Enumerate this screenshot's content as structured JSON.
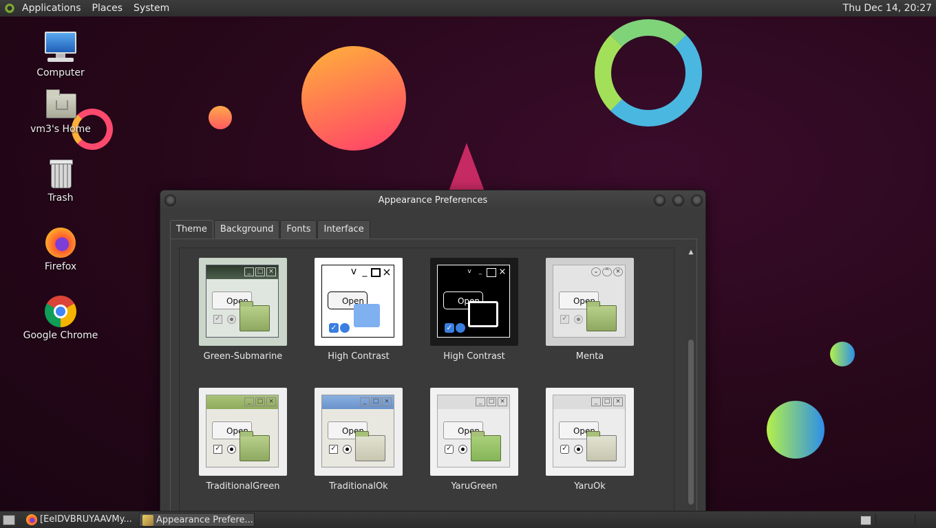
{
  "top_panel": {
    "menus": [
      "Applications",
      "Places",
      "System"
    ],
    "clock": "Thu Dec 14, 20:27"
  },
  "desktop_icons": [
    {
      "label": "Computer",
      "icon": "computer-icon"
    },
    {
      "label": "vm3's Home",
      "icon": "home-folder-icon"
    },
    {
      "label": "Trash",
      "icon": "trash-icon"
    },
    {
      "label": "Firefox",
      "icon": "firefox-icon"
    },
    {
      "label": "Google Chrome",
      "icon": "chrome-icon"
    }
  ],
  "window": {
    "title": "Appearance Preferences",
    "tabs": [
      "Theme",
      "Background",
      "Fonts",
      "Interface"
    ],
    "active_tab": "Theme",
    "themes": [
      {
        "name": "Green-Submarine",
        "open_label": "Open"
      },
      {
        "name": "High Contrast",
        "open_label": "Open"
      },
      {
        "name": "High Contrast",
        "open_label": "Open"
      },
      {
        "name": "Menta",
        "open_label": "Open"
      },
      {
        "name": "TraditionalGreen",
        "open_label": "Open"
      },
      {
        "name": "TraditionalOk",
        "open_label": "Open"
      },
      {
        "name": "YaruGreen",
        "open_label": "Open"
      },
      {
        "name": "YaruOk",
        "open_label": "Open"
      }
    ]
  },
  "taskbar": {
    "tasks": [
      {
        "label": "[EeIDVBRUYAAVMy...",
        "icon": "firefox-icon"
      },
      {
        "label": "Appearance Prefere...",
        "icon": "appearance-icon",
        "active": true
      }
    ]
  },
  "colors": {
    "desktop_bg": "#26071d",
    "panel_bg": "#333333",
    "window_bg": "#3b3b3b"
  }
}
